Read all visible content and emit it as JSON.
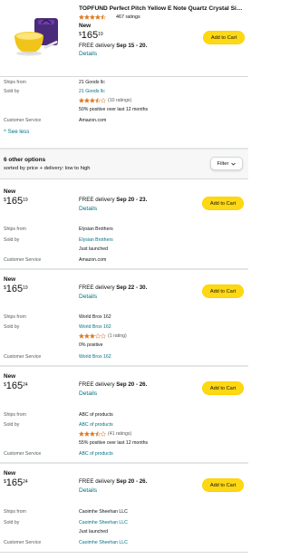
{
  "header": {
    "title": "TOPFUND Perfect Pitch Yellow E Note Quartz Crystal Singing Bowl",
    "rating_count": "467 ratings",
    "condition": "New",
    "price": {
      "symbol": "$",
      "whole": "165",
      "fraction": "19"
    },
    "delivery_prefix": "FREE delivery",
    "delivery_dates": "Sep 15 - 20.",
    "details": "Details",
    "add_to_cart": "Add to Cart"
  },
  "labels": {
    "ships_from": "Ships from",
    "sold_by": "Sold by",
    "customer_service": "Customer Service"
  },
  "main_seller": {
    "ships_from": "21 Goods llc",
    "sold_by": "21 Goods llc",
    "ratings": "(10 ratings)",
    "positive": "50% positive over last 12 months",
    "customer_service": "Amazon.com"
  },
  "see_less": "See less",
  "options": {
    "count": "6 other options",
    "sort": "sorted by price + delivery: low to high",
    "filter": "Filter"
  },
  "offers": [
    {
      "condition": "New",
      "price": {
        "symbol": "$",
        "whole": "165",
        "fraction": "19"
      },
      "delivery_prefix": "FREE delivery",
      "delivery_dates": "Sep 20 - 23.",
      "details": "Details",
      "add_to_cart": "Add to Cart",
      "ships_from": "Elysian Brothers",
      "sold_by": "Elysian Brothers",
      "note": "Just launched",
      "customer_service": "Amazon.com"
    },
    {
      "condition": "New",
      "price": {
        "symbol": "$",
        "whole": "165",
        "fraction": "19"
      },
      "delivery_prefix": "FREE delivery",
      "delivery_dates": "Sep 22 - 30.",
      "details": "Details",
      "add_to_cart": "Add to Cart",
      "ships_from": "World Brox 162",
      "sold_by": "World Brox 162",
      "ratings": "(1 rating)",
      "positive": "0% positive",
      "customer_service": "World Brox 162"
    },
    {
      "condition": "New",
      "price": {
        "symbol": "$",
        "whole": "165",
        "fraction": "24"
      },
      "delivery_prefix": "FREE delivery",
      "delivery_dates": "Sep 20 - 26.",
      "details": "Details",
      "add_to_cart": "Add to Cart",
      "ships_from": "ABC of products",
      "sold_by": "ABC of products",
      "ratings": "(41 ratings)",
      "positive": "55% positive over last 12 months",
      "customer_service": "ABC of products"
    },
    {
      "condition": "New",
      "price": {
        "symbol": "$",
        "whole": "165",
        "fraction": "24"
      },
      "delivery_prefix": "FREE delivery",
      "delivery_dates": "Sep 20 - 26.",
      "details": "Details",
      "add_to_cart": "Add to Cart",
      "ships_from": "Caoimhe Sheehan LLC",
      "sold_by": "Caoimhe Sheehan LLC",
      "note": "Just launched",
      "customer_service": "Caoimhe Sheehan LLC"
    }
  ],
  "colors": {
    "link": "#007185",
    "button": "#ffd814",
    "star": "#de7921",
    "secondary_text": "#565959"
  }
}
